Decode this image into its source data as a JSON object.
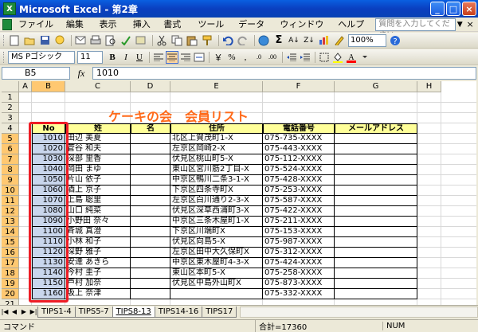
{
  "window": {
    "title": "Microsoft Excel - 第2章",
    "min": "_",
    "max": "□",
    "close": "×"
  },
  "menu": {
    "items": [
      "ファイル(F)",
      "編集(E)",
      "表示(V)",
      "挿入(I)",
      "書式(O)",
      "ツール(T)",
      "データ(D)",
      "ウィンドウ(W)",
      "ヘルプ(H)"
    ],
    "help_placeholder": "質問を入力してください"
  },
  "toolbar": {
    "zoom": "100%"
  },
  "format_toolbar": {
    "font": "MS Pゴシック",
    "size": "11",
    "bold": "B",
    "italic": "I",
    "underline": "U"
  },
  "formula_bar": {
    "name_box": "B5",
    "fx": "fx",
    "value": "1010"
  },
  "columns": [
    "A",
    "B",
    "C",
    "D",
    "E",
    "F",
    "G",
    "H"
  ],
  "rows": [
    "1",
    "2",
    "3",
    "4",
    "5",
    "6",
    "7",
    "8",
    "9",
    "10",
    "11",
    "12",
    "13",
    "14",
    "15",
    "16",
    "17",
    "18",
    "19",
    "20",
    "21",
    "22"
  ],
  "sheet": {
    "title": "ケーキの会　会員リスト",
    "headers": {
      "no": "No",
      "sei": "姓",
      "mei": "名",
      "address": "住所",
      "phone": "電話番号",
      "email": "メールアドレス"
    },
    "records": [
      {
        "no": "1010",
        "name": "田辺 美夏",
        "address": "北区上賀茂町1-X",
        "phone": "075-735-XXXX"
      },
      {
        "no": "1020",
        "name": "菅谷 和夫",
        "address": "左京区岡崎2-X",
        "phone": "075-443-XXXX"
      },
      {
        "no": "1030",
        "name": "深部 里香",
        "address": "伏見区桃山町5-X",
        "phone": "075-112-XXXX"
      },
      {
        "no": "1040",
        "name": "岡田 まゆ",
        "address": "東山区宮川筋2丁目-X",
        "phone": "075-524-XXXX"
      },
      {
        "no": "1050",
        "name": "片山 依子",
        "address": "中京区鴨川二条3-1-X",
        "phone": "075-428-XXXX"
      },
      {
        "no": "1060",
        "name": "酒上 京子",
        "address": "下京区四条寺町X",
        "phone": "075-253-XXXX"
      },
      {
        "no": "1070",
        "name": "上島 聡里",
        "address": "左京区白川通り2-3-X",
        "phone": "075-587-XXXX"
      },
      {
        "no": "1080",
        "name": "山口 純菜",
        "address": "伏見区深草西浦町3-X",
        "phone": "075-422-XXXX"
      },
      {
        "no": "1090",
        "name": "小野田 奈々",
        "address": "中京区三条木屋町1-X",
        "phone": "075-211-XXXX"
      },
      {
        "no": "1100",
        "name": "斉城 真澄",
        "address": "下京区川端町X",
        "phone": "075-153-XXXX"
      },
      {
        "no": "1110",
        "name": "小林 和子",
        "address": "伏見区向島5-X",
        "phone": "075-987-XXXX"
      },
      {
        "no": "1120",
        "name": "深野 雅子",
        "address": "左京区田中大久保町X",
        "phone": "075-312-XXXX"
      },
      {
        "no": "1130",
        "name": "安達 あきら",
        "address": "中京区東木屋町4-3-X",
        "phone": "075-424-XXXX"
      },
      {
        "no": "1140",
        "name": "今村 圭子",
        "address": "東山区本町5-X",
        "phone": "075-258-XXXX"
      },
      {
        "no": "1150",
        "name": "芦村 加奈",
        "address": "伏見区中島外山町X",
        "phone": "075-873-XXXX"
      },
      {
        "no": "1160",
        "name": "坂上 奈津",
        "address": "",
        "phone": "075-332-XXXX"
      }
    ]
  },
  "sheet_tabs": [
    "TIPS1-4",
    "TIPS5-7",
    "TIPS8-13",
    "TIPS14-16",
    "TIPS17"
  ],
  "active_tab": "TIPS8-13",
  "status": {
    "mode": "コマンド",
    "sum": "合計=17360",
    "num": "NUM"
  }
}
